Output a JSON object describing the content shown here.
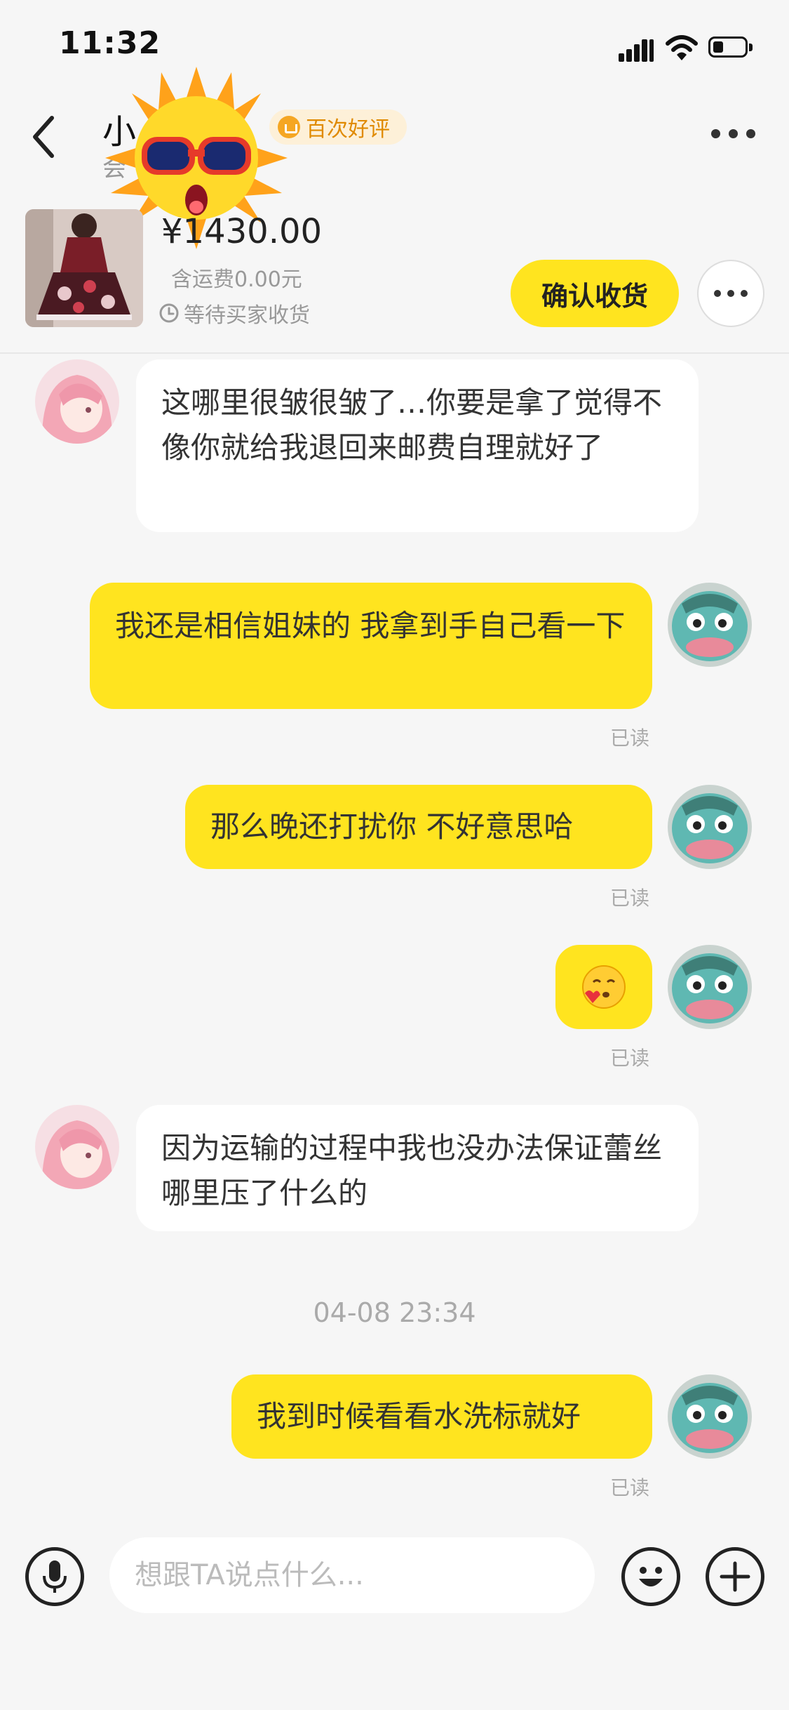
{
  "status_bar": {
    "time": "11:32"
  },
  "header": {
    "seller_name": "小",
    "seller_sub": "会",
    "badge": "百次好评"
  },
  "order": {
    "price": "¥1430.00",
    "shipping": "含运费0.00元",
    "status": "等待买家收货",
    "confirm_label": "确认收货"
  },
  "messages": [
    {
      "side": "left",
      "text": "这哪里很皱很皱了…你要是拿了觉得不像你就给我退回来邮费自理就好了"
    },
    {
      "side": "right",
      "text": "我还是相信姐妹的 我拿到手自己看一下",
      "read": "已读"
    },
    {
      "side": "right",
      "text": "那么晚还打扰你 不好意思哈",
      "read": "已读"
    },
    {
      "side": "right",
      "emoji": "kissing-face-emoji",
      "read": "已读"
    },
    {
      "side": "left",
      "text": "因为运输的过程中我也没办法保证蕾丝哪里压了什么的"
    },
    {
      "side": "right",
      "text": "我到时候看看水洗标就好",
      "read": "已读"
    }
  ],
  "timestamp": "04-08 23:34",
  "input": {
    "placeholder": "想跟TA说点什么..."
  },
  "colors": {
    "accent": "#ffe41f",
    "background": "#f6f6f6",
    "badge_text": "#e08a00"
  },
  "icons": [
    "back-arrow-icon",
    "more-dots-icon",
    "clock-icon",
    "mic-icon",
    "emoji-icon",
    "plus-icon"
  ]
}
